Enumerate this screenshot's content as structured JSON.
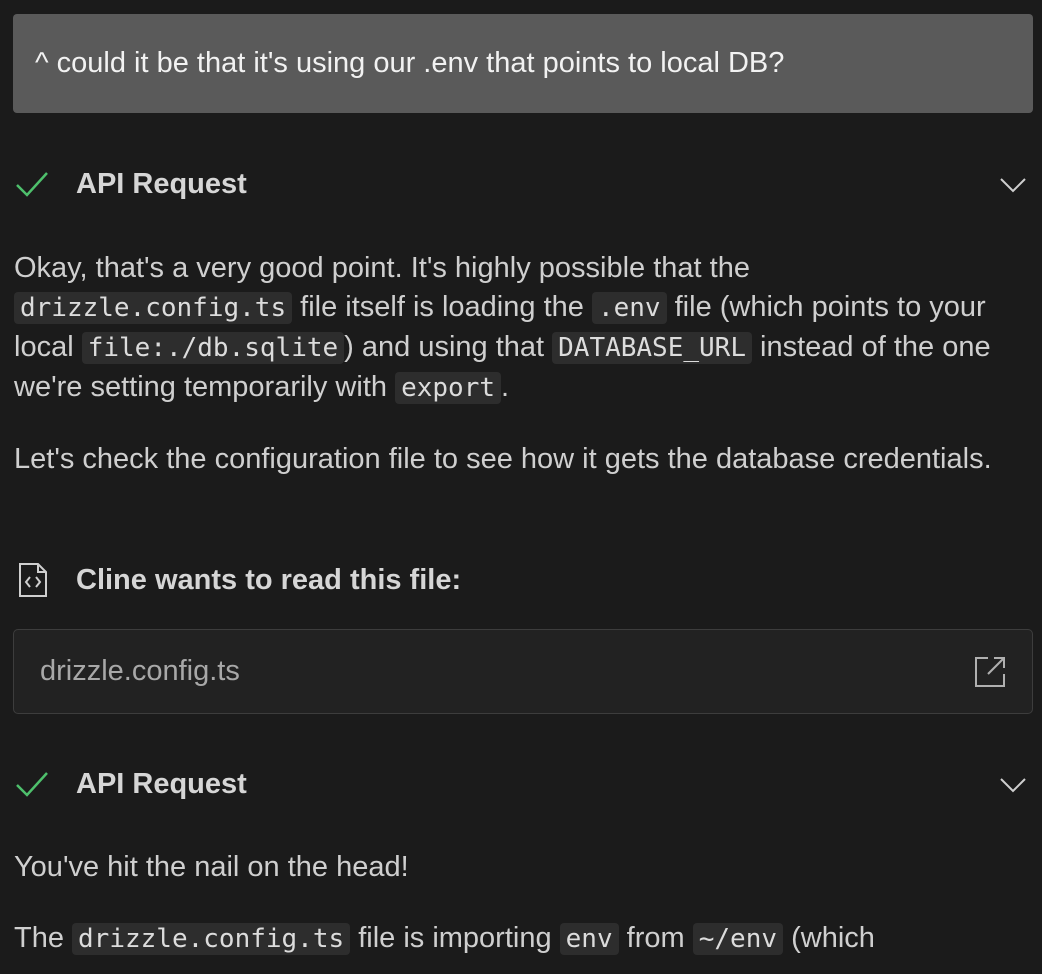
{
  "user_message": "^ could it be that it's using our .env that points to local DB?",
  "api_request_1": {
    "label": "API Request",
    "status": "success"
  },
  "response_1": {
    "p1": {
      "t1": "Okay, that's a very good point. It's highly possible that the ",
      "c1": "drizzle.config.ts",
      "t2": " file itself is loading the ",
      "c2": ".env",
      "t3": " file (which points to your local ",
      "c3": "file:./db.sqlite",
      "t4": ") and using that ",
      "c4": "DATABASE_URL",
      "t5": " instead of the one we're setting temporarily with ",
      "c5": "export",
      "t6": "."
    },
    "p2": "Let's check the configuration file to see how it gets the database credentials."
  },
  "read_file": {
    "title": "Cline wants to read this file:",
    "filename": "drizzle.config.ts"
  },
  "api_request_2": {
    "label": "API Request",
    "status": "success"
  },
  "response_2": {
    "p1": "You've hit the nail on the head!",
    "p2": {
      "t1": "The ",
      "c1": "drizzle.config.ts",
      "t2": " file is importing ",
      "c2": "env",
      "t3": " from ",
      "c3": "~/env",
      "t4": " (which"
    }
  },
  "colors": {
    "check": "#4ec06c",
    "user_bubble": "#5a5a5a",
    "background": "#1b1b1b"
  }
}
